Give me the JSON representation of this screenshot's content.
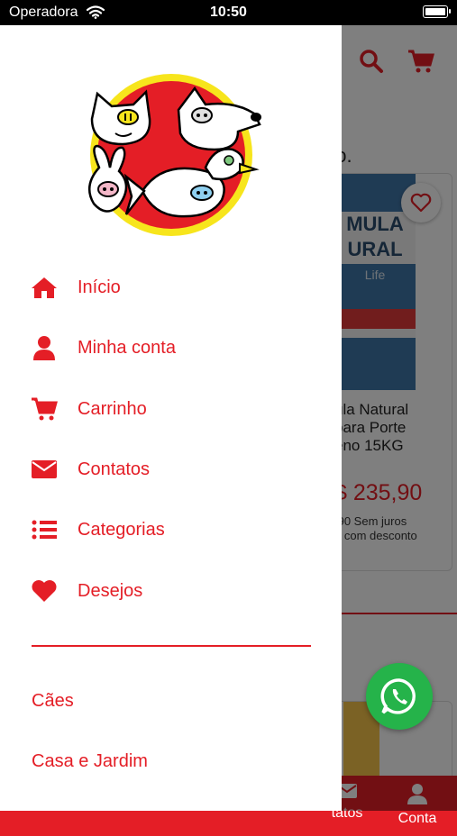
{
  "status_bar": {
    "carrier": "Operadora",
    "time": "10:50"
  },
  "colors": {
    "accent": "#e41e26",
    "whatsapp": "#25b34a"
  },
  "drawer": {
    "menu": [
      {
        "label": "Início",
        "icon": "home-icon"
      },
      {
        "label": "Minha conta",
        "icon": "user-icon"
      },
      {
        "label": "Carrinho",
        "icon": "cart-icon"
      },
      {
        "label": "Contatos",
        "icon": "envelope-icon"
      },
      {
        "label": "Categorias",
        "icon": "list-icon"
      },
      {
        "label": "Desejos",
        "icon": "heart-icon"
      }
    ],
    "categories": [
      "Cães",
      "Casa e Jardim"
    ]
  },
  "background": {
    "subtitle": "do.",
    "product": {
      "brand_text": "MULA\nURAL",
      "line": "Life",
      "name": "ula Natural\npara Porte\neno 15KG",
      "price": "$ 235,90",
      "installments": ",90 Sem juros\na com desconto"
    },
    "bottom_nav": [
      {
        "label": "tatos",
        "icon": "envelope-icon"
      },
      {
        "label": "Conta",
        "icon": "user-icon"
      }
    ]
  }
}
